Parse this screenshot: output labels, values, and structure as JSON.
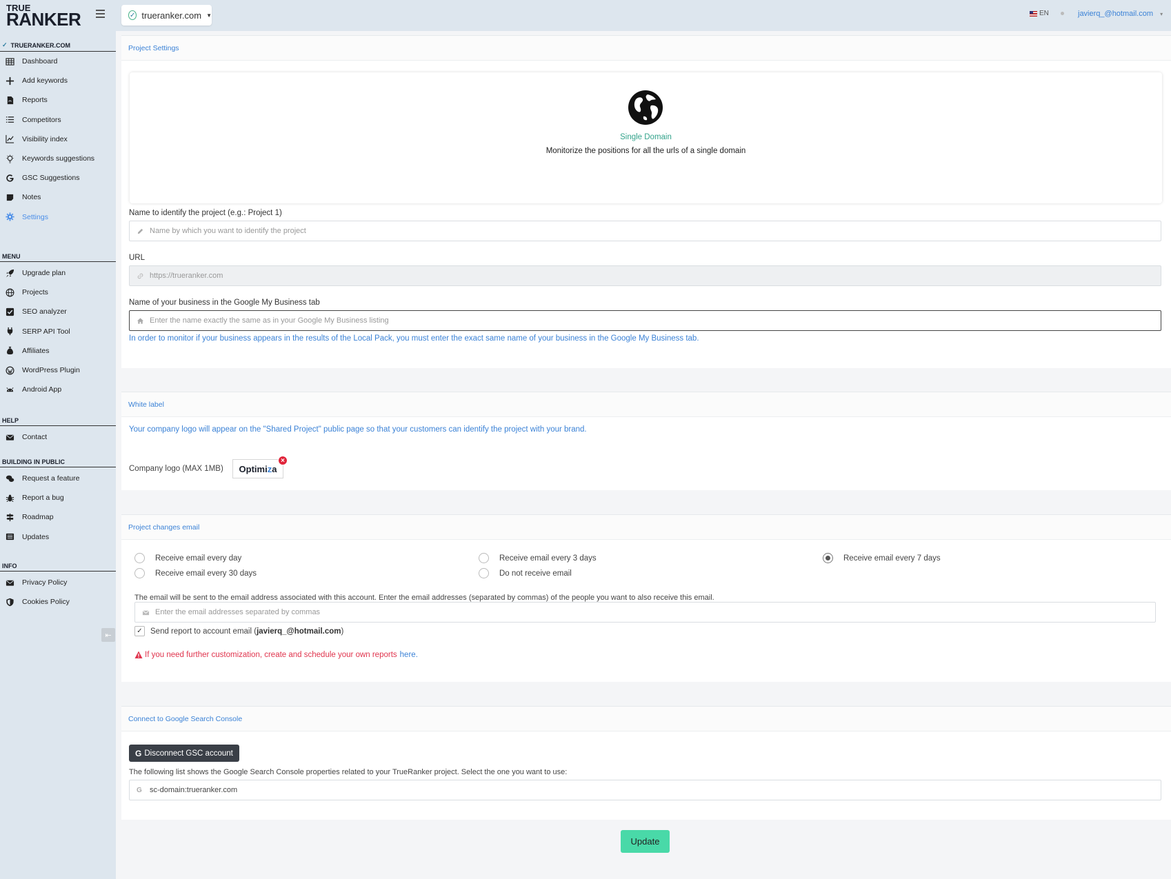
{
  "header": {
    "logo_line1": "TRUE",
    "logo_line2": "RANKER",
    "project": "trueranker.com",
    "language": "EN",
    "user_email": "javierq_@hotmail.com"
  },
  "sidebar": {
    "project_name": "TRUERANKER.COM",
    "project_items": [
      {
        "label": "Dashboard",
        "icon": "table-icon"
      },
      {
        "label": "Add keywords",
        "icon": "plus-icon"
      },
      {
        "label": "Reports",
        "icon": "pdf-file-icon"
      },
      {
        "label": "Competitors",
        "icon": "list-icon"
      },
      {
        "label": "Visibility index",
        "icon": "line-chart-icon"
      },
      {
        "label": "Keywords suggestions",
        "icon": "lightbulb-icon"
      },
      {
        "label": "GSC Suggestions",
        "icon": "google-icon"
      },
      {
        "label": "Notes",
        "icon": "note-icon"
      },
      {
        "label": "Settings",
        "icon": "gear-icon",
        "active": true
      }
    ],
    "menu_title": "MENU",
    "menu_items": [
      {
        "label": "Upgrade plan",
        "icon": "rocket-icon"
      },
      {
        "label": "Projects",
        "icon": "globe-icon"
      },
      {
        "label": "SEO analyzer",
        "icon": "checkbox-icon"
      },
      {
        "label": "SERP API Tool",
        "icon": "plug-icon"
      },
      {
        "label": "Affiliates",
        "icon": "money-bag-icon"
      },
      {
        "label": "WordPress Plugin",
        "icon": "wordpress-icon"
      },
      {
        "label": "Android App",
        "icon": "android-icon"
      }
    ],
    "help_title": "HELP",
    "help_items": [
      {
        "label": "Contact",
        "icon": "envelope-icon"
      }
    ],
    "building_title": "BUILDING IN PUBLIC",
    "building_items": [
      {
        "label": "Request a feature",
        "icon": "comments-icon"
      },
      {
        "label": "Report a bug",
        "icon": "bug-icon"
      },
      {
        "label": "Roadmap",
        "icon": "signpost-icon"
      },
      {
        "label": "Updates",
        "icon": "newspaper-icon"
      }
    ],
    "info_title": "INFO",
    "info_items": [
      {
        "label": "Privacy Policy",
        "icon": "envelope-icon"
      },
      {
        "label": "Cookies Policy",
        "icon": "shield-icon"
      }
    ]
  },
  "project_settings": {
    "title": "Project Settings",
    "domain_type_title": "Single Domain",
    "domain_type_desc": "Monitorize the positions for all the urls of a single domain",
    "name_label": "Name to identify the project (e.g.: Project 1)",
    "name_placeholder": "Name by which you want to identify the project",
    "url_label": "URL",
    "url_value": "https://trueranker.com",
    "business_label": "Name of your business in the Google My Business tab",
    "business_placeholder": "Enter the name exactly the same as in your Google My Business listing",
    "business_note": "In order to monitor if your business appears in the results of the Local Pack, you must enter the exact same name of your business in the Google My Business tab."
  },
  "white_label": {
    "title": "White label",
    "note": "Your company logo will appear on the \"Shared Project\" public page so that your customers can identify the project with your brand.",
    "logo_label": "Company logo (MAX 1MB)",
    "logo_text_a": "Optimi",
    "logo_text_b": "z",
    "logo_text_c": "a",
    "remove_symbol": "×"
  },
  "project_email": {
    "title": "Project changes email",
    "options": [
      {
        "label": "Receive email every day",
        "selected": false
      },
      {
        "label": "Receive email every 3 days",
        "selected": false
      },
      {
        "label": "Receive email every 7 days",
        "selected": true
      },
      {
        "label": "Receive email every 30 days",
        "selected": false
      },
      {
        "label": "Do not receive email",
        "selected": false
      }
    ],
    "note": "The email will be sent to the email address associated with this account. Enter the email addresses (separated by commas) of the people you want to also receive this email.",
    "emails_placeholder": "Enter the email addresses separated by commas",
    "send_to_account_label": "Send report to account email (",
    "send_to_account_email": "javierq_@hotmail.com",
    "send_to_account_close": ")",
    "send_to_account_checked": true,
    "warning_text": "If you need further customization, create and schedule your own reports",
    "warning_link": "here",
    "warning_end": "."
  },
  "gsc": {
    "title": "Connect to Google Search Console",
    "disconnect_label": "Disconnect GSC account",
    "note": "The following list shows the Google Search Console properties related to your TrueRanker project. Select the one you want to use:",
    "property_value": "sc-domain:trueranker.com"
  },
  "update_label": "Update",
  "colors": {
    "accent": "#3b82d6",
    "success": "#49d9a8",
    "danger": "#e0344d",
    "sidebar_bg": "#dde6ee"
  }
}
